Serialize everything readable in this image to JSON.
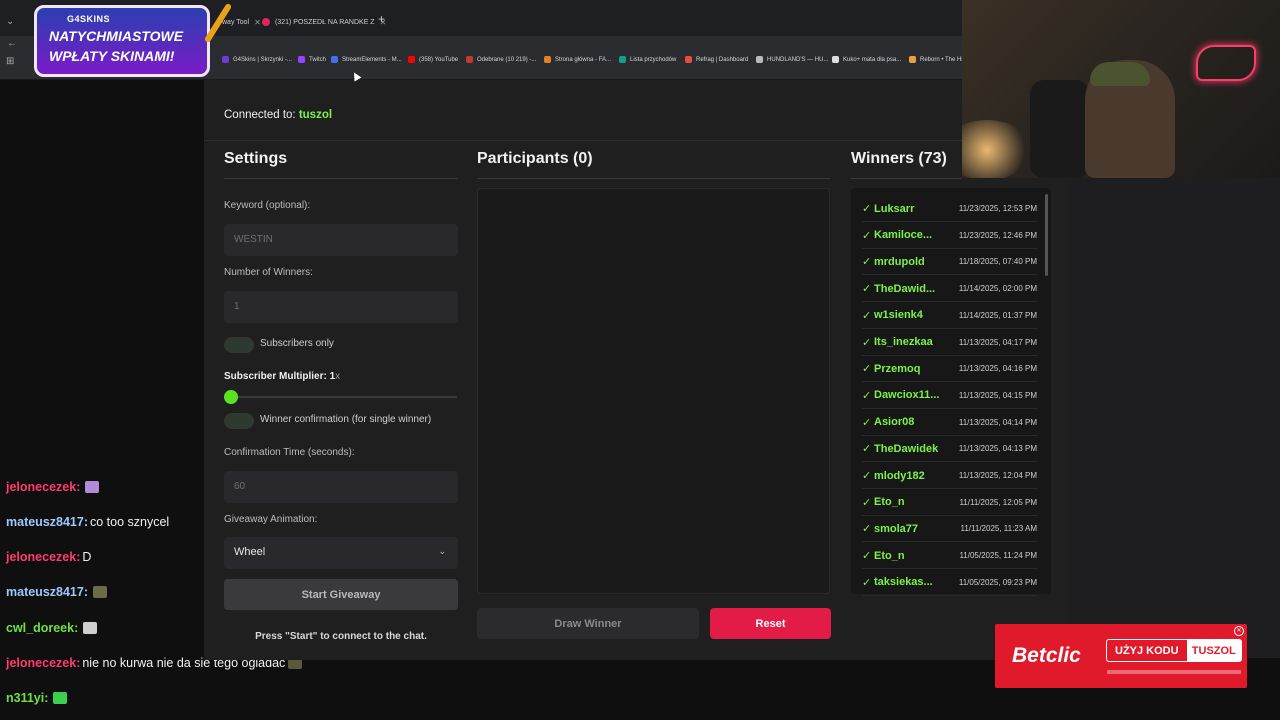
{
  "browser": {
    "tabs": [
      {
        "label": "way Tool"
      },
      {
        "label": "(321) POSZEDŁ NA RANDKE Z"
      }
    ],
    "bookmarks": [
      {
        "label": "G4Skins | Skrzynki -...",
        "color": "#6d3cd6"
      },
      {
        "label": "Twitch",
        "color": "#9146ff"
      },
      {
        "label": "StreamElements - M...",
        "color": "#3d6ef5"
      },
      {
        "label": "(358) YouTube",
        "color": "#ff0000"
      },
      {
        "label": "Odebrane (10 219) -...",
        "color": "#c0392b"
      },
      {
        "label": "Strona główna - FA...",
        "color": "#e67e22"
      },
      {
        "label": "Lista przychodów",
        "color": "#16a085"
      },
      {
        "label": "Refrag | Dashboard",
        "color": "#e74c3c"
      },
      {
        "label": "HUNDLAND'S — HU...",
        "color": "#bbbbbb"
      },
      {
        "label": "Kuko+ mata dla psa...",
        "color": "#dddddd"
      },
      {
        "label": "Reborn • The Hi",
        "color": "#e6a23c"
      }
    ]
  },
  "promo": {
    "brand": "G4SKINS",
    "line1": "NATYCHMIASTOWE",
    "line2": "WPŁATY SKINAMI!"
  },
  "tool": {
    "connected_prefix": "Connected to:",
    "connected_channel": "tuszol",
    "settings": {
      "title": "Settings",
      "keyword_label": "Keyword (optional):",
      "keyword_value": "WESTIN",
      "winners_label": "Number of Winners:",
      "winners_value": "1",
      "subscribers_only_label": "Subscribers only",
      "multiplier_label": "Subscriber Multiplier: 1",
      "multiplier_suffix": "x",
      "winner_confirmation_label": "Winner confirmation (for single winner)",
      "confirmation_time_label": "Confirmation Time (seconds):",
      "confirmation_time_value": "60",
      "animation_label": "Giveaway Animation:",
      "animation_value": "Wheel",
      "start_button": "Start Giveaway",
      "hint": "Press \"Start\" to connect to the chat."
    },
    "participants": {
      "title": "Participants (0)",
      "draw_button": "Draw Winner",
      "reset_button": "Reset"
    },
    "winners": {
      "title": "Winners (73)",
      "check": "✓",
      "list": [
        {
          "name": "Luksarr",
          "date": "11/23/2025, 12:53 PM"
        },
        {
          "name": "Kamiloce...",
          "date": "11/23/2025, 12:46 PM"
        },
        {
          "name": "mrdupold",
          "date": "11/18/2025, 07:40 PM"
        },
        {
          "name": "TheDawid...",
          "date": "11/14/2025, 02:00 PM"
        },
        {
          "name": "w1sienk4",
          "date": "11/14/2025, 01:37 PM"
        },
        {
          "name": "Its_inezkaa",
          "date": "11/13/2025, 04:17 PM"
        },
        {
          "name": "Przemoq",
          "date": "11/13/2025, 04:16 PM"
        },
        {
          "name": "Dawciox11...",
          "date": "11/13/2025, 04:15 PM"
        },
        {
          "name": "Asior08",
          "date": "11/13/2025, 04:14 PM"
        },
        {
          "name": "TheDawidek",
          "date": "11/13/2025, 04:13 PM"
        },
        {
          "name": "mlody182",
          "date": "11/13/2025, 12:04 PM"
        },
        {
          "name": "Eto_n",
          "date": "11/11/2025, 12:05 PM"
        },
        {
          "name": "smola77",
          "date": "11/11/2025, 11:23 AM"
        },
        {
          "name": "Eto_n",
          "date": "11/05/2025, 11:24 PM"
        },
        {
          "name": "taksiekas...",
          "date": "11/05/2025, 09:23 PM"
        }
      ]
    }
  },
  "chat": [
    {
      "user": "jelonecezek",
      "color": "#ff3b6b",
      "text": "",
      "emote": "#b38ad6"
    },
    {
      "user": "mateusz8417",
      "color": "#9ec9ff",
      "text": "co too sznycel",
      "emote": ""
    },
    {
      "user": "jelonecezek",
      "color": "#ff3b6b",
      "text": "D",
      "emote": ""
    },
    {
      "user": "mateusz8417",
      "color": "#9ec9ff",
      "text": "",
      "emote": "#6b6b4a"
    },
    {
      "user": "cwl_doreek",
      "color": "#6ee04a",
      "text": "",
      "emote": "#cfcfcf"
    },
    {
      "user": "jelonecezek",
      "color": "#ff3b6b",
      "text": "nie no kurwa nie da sie tego ogladac",
      "emote": "#5a5a3a"
    },
    {
      "user": "n311yi",
      "color": "#6ee04a",
      "text": "",
      "emote": "#3ccf4e"
    }
  ],
  "ad": {
    "brand": "Betclic",
    "code_label": "UŻYJ KODU",
    "code_value": "TUSZOL"
  }
}
